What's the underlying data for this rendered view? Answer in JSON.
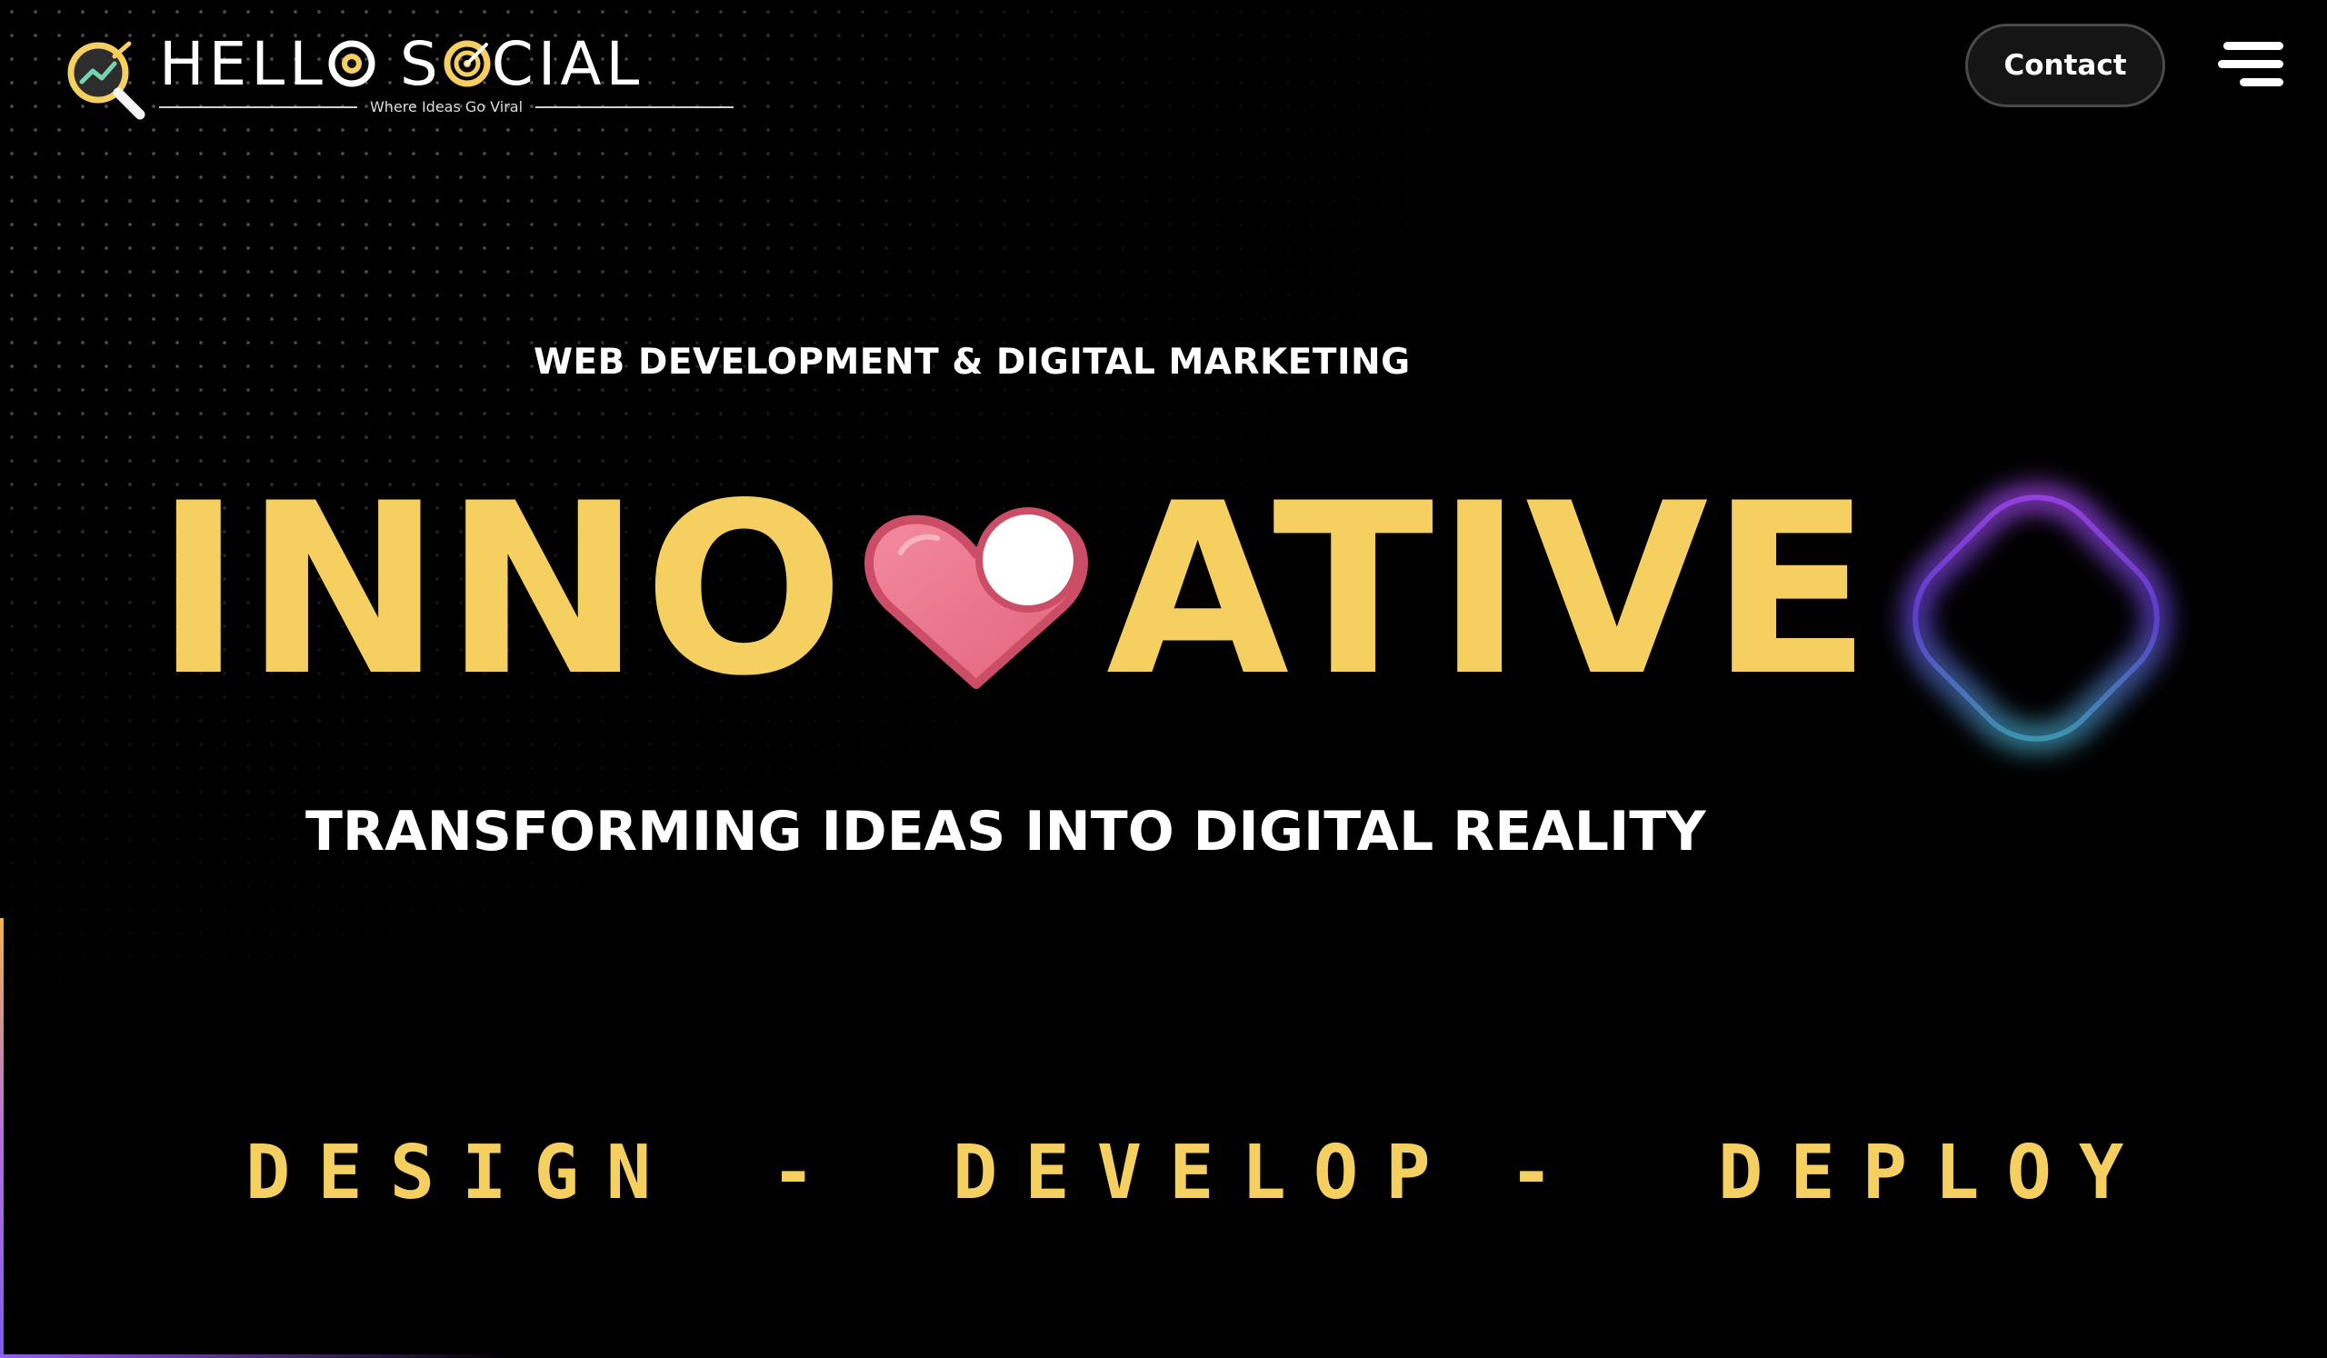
{
  "header": {
    "brand_left": "HELL",
    "brand_mid": "S",
    "brand_right": "CIAL",
    "tagline": "Where Ideas Go Viral",
    "contact_label": "Contact"
  },
  "hero": {
    "eyebrow": "WEB DEVELOPMENT & DIGITAL MARKETING",
    "headline_before": "INNO",
    "headline_after": "ATIVE",
    "subheadline": "TRANSFORMING IDEAS INTO DIGITAL REALITY"
  },
  "steps": {
    "items": [
      "DESIGN",
      "-",
      "DEVELOP",
      "-",
      "DEPLOY"
    ]
  },
  "colors": {
    "accent_yellow": "#f5d061",
    "heart_pink": "#e86b84",
    "background": "#000000"
  },
  "icons": [
    "magnifier-logo-icon",
    "target-o-icon",
    "heart-toggle-icon",
    "hamburger-menu-icon",
    "glow-shape-icon"
  ]
}
